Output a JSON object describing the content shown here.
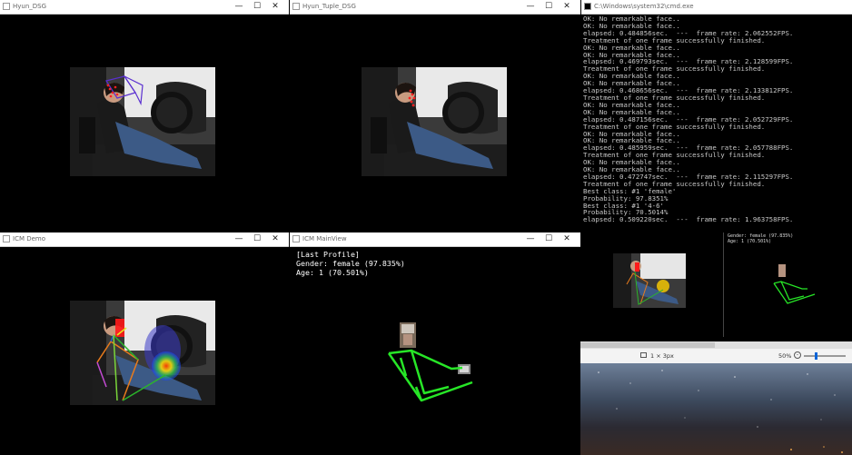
{
  "windows": {
    "hyun_dsg": {
      "title": "Hyun_DSG"
    },
    "hyun_tuple": {
      "title": "Hyun_Tuple_DSG"
    },
    "console": {
      "title": "C:\\Windows\\system32\\cmd.exe"
    },
    "icm_demo": {
      "title": "ICM Demo"
    },
    "icm_mainview": {
      "title": "ICM MainView"
    }
  },
  "console_lines": [
    "OK: No remarkable face..",
    "OK: No remarkable face..",
    "elapsed: 0.484856sec.  ---  frame rate: 2.062552FPS.",
    "Treatment of one frame successfully finished.",
    "OK: No remarkable face..",
    "OK: No remarkable face..",
    "elapsed: 0.469793sec.  ---  frame rate: 2.128599FPS.",
    "Treatment of one frame successfully finished.",
    "OK: No remarkable face..",
    "OK: No remarkable face..",
    "elapsed: 0.468656sec.  ---  frame rate: 2.133812FPS.",
    "Treatment of one frame successfully finished.",
    "OK: No remarkable face..",
    "OK: No remarkable face..",
    "elapsed: 0.487156sec.  ---  frame rate: 2.052729FPS.",
    "Treatment of one frame successfully finished.",
    "OK: No remarkable face..",
    "OK: No remarkable face..",
    "elapsed: 0.485959sec.  ---  frame rate: 2.057788FPS.",
    "Treatment of one frame successfully finished.",
    "OK: No remarkable face..",
    "OK: No remarkable face..",
    "elapsed: 0.472747sec.  ---  frame rate: 2.115297FPS.",
    "Treatment of one frame successfully finished.",
    "Best class: #1 'female'",
    "Probability: 97.8351%",
    "Best class: #1 '4-6'",
    "Probability: 70.5014%",
    "elapsed: 0.509220sec.  ---  frame rate: 1.963758FPS."
  ],
  "profile": {
    "heading": "[Last Profile]",
    "gender": "Gender: female (97.835%)",
    "age": "Age: 1 (70.501%)"
  },
  "preview": {
    "gender": "Gender: female (97.835%)",
    "age": "Age: 1 (70.501%)"
  },
  "viewer": {
    "dimensions": "1 × 3px",
    "zoom": "50%"
  },
  "colors": {
    "skeleton": "#27e627",
    "face_box": "#5a2fd0",
    "face_dots": "#ff2020"
  }
}
